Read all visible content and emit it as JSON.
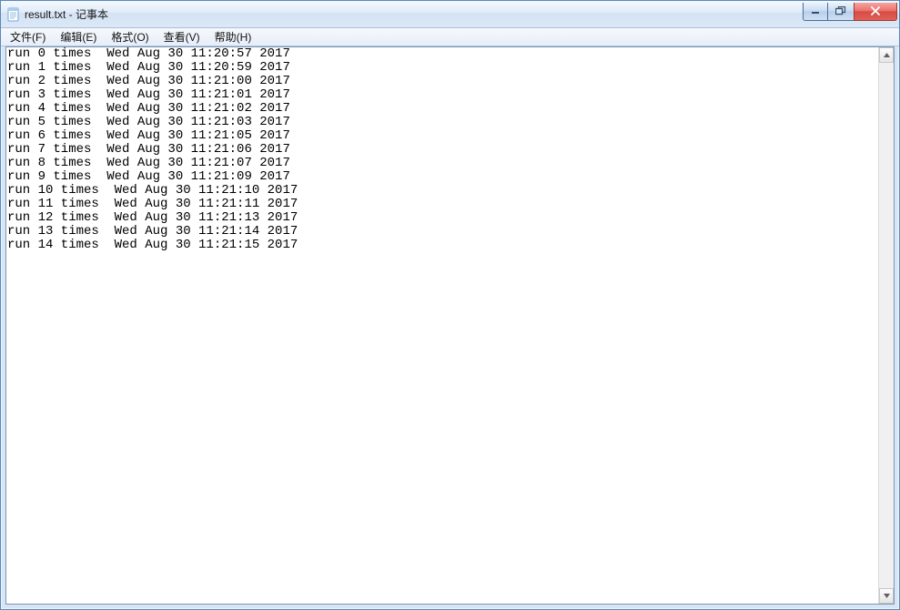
{
  "window": {
    "title": "result.txt - 记事本"
  },
  "menu": {
    "file": "文件(F)",
    "edit": "编辑(E)",
    "format": "格式(O)",
    "view": "查看(V)",
    "help": "帮助(H)"
  },
  "content": {
    "lines": [
      "run 0 times  Wed Aug 30 11:20:57 2017",
      "run 1 times  Wed Aug 30 11:20:59 2017",
      "run 2 times  Wed Aug 30 11:21:00 2017",
      "run 3 times  Wed Aug 30 11:21:01 2017",
      "run 4 times  Wed Aug 30 11:21:02 2017",
      "run 5 times  Wed Aug 30 11:21:03 2017",
      "run 6 times  Wed Aug 30 11:21:05 2017",
      "run 7 times  Wed Aug 30 11:21:06 2017",
      "run 8 times  Wed Aug 30 11:21:07 2017",
      "run 9 times  Wed Aug 30 11:21:09 2017",
      "run 10 times  Wed Aug 30 11:21:10 2017",
      "run 11 times  Wed Aug 30 11:21:11 2017",
      "run 12 times  Wed Aug 30 11:21:13 2017",
      "run 13 times  Wed Aug 30 11:21:14 2017",
      "run 14 times  Wed Aug 30 11:21:15 2017"
    ]
  }
}
